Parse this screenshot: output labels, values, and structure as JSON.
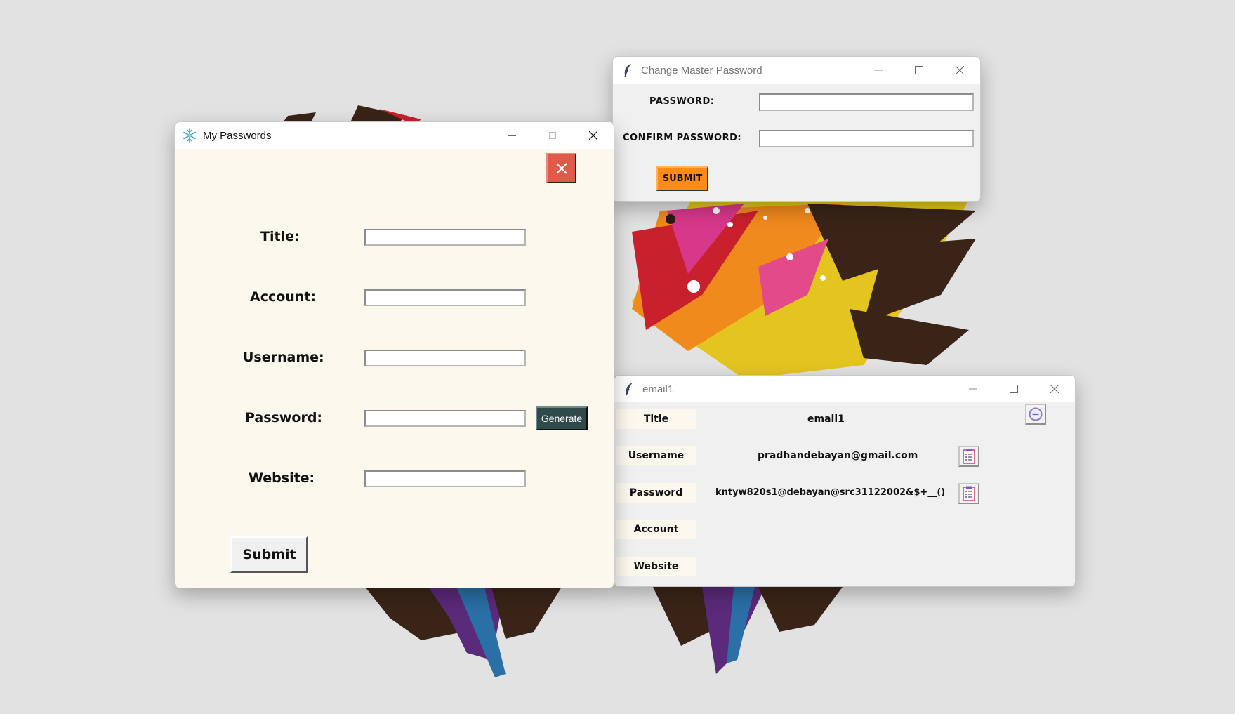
{
  "colors": {
    "desktop_bg": "#e2e2e2",
    "form_bg": "#fdf8ee",
    "close_red": "#e05a4a",
    "submit_orange": "#ff8c1a",
    "generate_dark": "#2f4a4a"
  },
  "master_window": {
    "title": "Change Master Password",
    "icon": "feather-icon",
    "password_label": "PASSWORD:",
    "confirm_label": "CONFIRM PASSWORD:",
    "password_value": "",
    "confirm_value": "",
    "submit_label": "SUBMIT"
  },
  "passwords_window": {
    "title": "My Passwords",
    "icon": "snowflake-icon",
    "close_icon": "close-icon",
    "labels": {
      "title": "Title:",
      "account": "Account:",
      "username": "Username:",
      "password": "Password:",
      "website": "Website:"
    },
    "values": {
      "title": "",
      "account": "",
      "username": "",
      "password": "",
      "website": ""
    },
    "generate_label": "Generate",
    "submit_label": "Submit"
  },
  "entry_window": {
    "title": "email1",
    "icon": "feather-icon",
    "labels": {
      "title": "Title",
      "username": "Username",
      "password": "Password",
      "account": "Account",
      "website": "Website"
    },
    "values": {
      "title": "email1",
      "username": "pradhandebayan@gmail.com",
      "password": "kntyw820s1@debayan@src31122002&$+__()",
      "account": "",
      "website": ""
    },
    "delete_icon": "minus-circle-icon",
    "copy_icon": "clipboard-icon"
  }
}
